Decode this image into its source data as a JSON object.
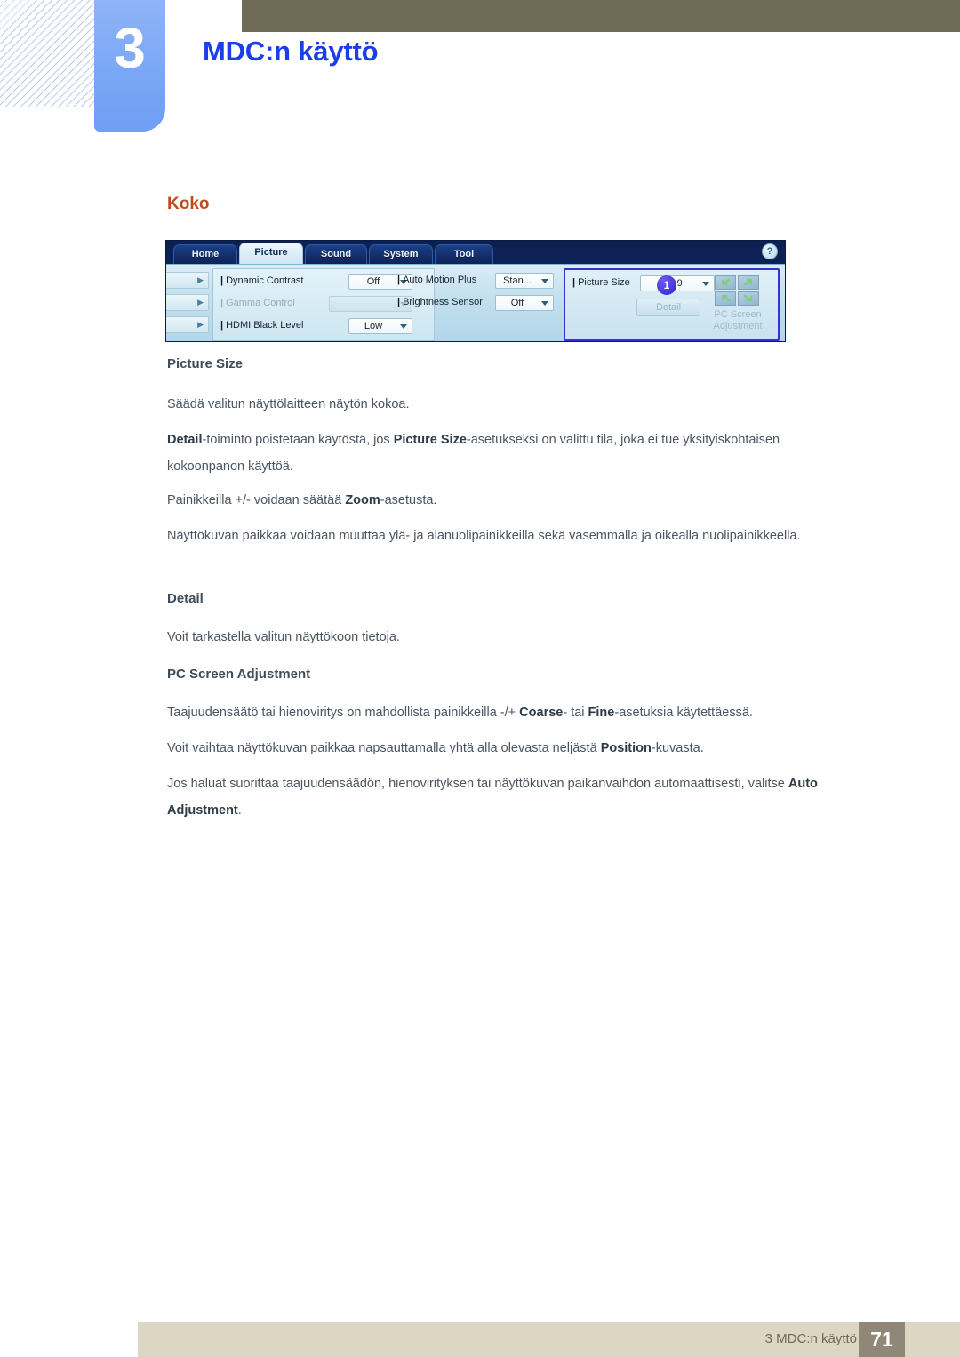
{
  "header": {
    "chapter_number": "3",
    "title": "MDC:n käyttö"
  },
  "section": {
    "heading": "Koko"
  },
  "mdc_app": {
    "tabs": [
      {
        "label": "Home",
        "active": false
      },
      {
        "label": "Picture",
        "active": true
      },
      {
        "label": "Sound",
        "active": false
      },
      {
        "label": "System",
        "active": false
      },
      {
        "label": "Tool",
        "active": false
      }
    ],
    "help_icon": "?",
    "left_group": [
      {
        "label": "Dynamic Contrast",
        "value": "Off",
        "disabled": false
      },
      {
        "label": "Gamma Control",
        "value": "",
        "disabled": true
      },
      {
        "label": "HDMI Black Level",
        "value": "Low",
        "disabled": false
      }
    ],
    "middle_group": [
      {
        "label": "Auto Motion Plus",
        "value": "Stan...",
        "disabled": false
      },
      {
        "label": "Brightness Sensor",
        "value": "Off",
        "disabled": false
      }
    ],
    "right_group": {
      "callout_badge": "1",
      "picture_size_label": "Picture Size",
      "picture_size_value": "16 : 9",
      "detail_button": "Detail",
      "pc_screen_adjustment_label": "PC Screen Adjustment"
    }
  },
  "content": {
    "h_picture_size": "Picture Size",
    "p1": "Säädä valitun näyttölaitteen näytön kokoa.",
    "p2_a": "Detail",
    "p2_b": "-toiminto poistetaan käytöstä, jos ",
    "p2_c": "Picture Size",
    "p2_d": "-asetukseksi on valittu tila, joka ei tue yksityiskohtaisen kokoonpanon käyttöä.",
    "p3_a": "Painikkeilla +/- voidaan säätää ",
    "p3_b": "Zoom",
    "p3_c": "-asetusta.",
    "p4": "Näyttökuvan paikkaa voidaan muuttaa ylä- ja alanuolipainikkeilla sekä vasemmalla ja oikealla nuolipainikkeella.",
    "h_detail": "Detail",
    "p5": "Voit tarkastella valitun näyttökoon tietoja.",
    "h_pcsa": "PC Screen Adjustment",
    "p6_a": "Taajuudensäätö tai hienoviritys on mahdollista painikkeilla -/+ ",
    "p6_b": "Coarse",
    "p6_c": "- tai ",
    "p6_d": "Fine",
    "p6_e": "-asetuksia käytettäessä.",
    "p7_a": "Voit vaihtaa näyttökuvan paikkaa napsauttamalla yhtä alla olevasta neljästä ",
    "p7_b": "Position",
    "p7_c": "-kuvasta.",
    "p8_a": "Jos haluat suorittaa taajuudensäädön, hienovirityksen tai näyttökuvan paikanvaihdon automaattisesti, valitse ",
    "p8_b": "Auto Adjustment",
    "p8_c": "."
  },
  "footer": {
    "text": "3 MDC:n käyttö",
    "page_number": "71"
  },
  "colors": {
    "header_bar": "#6e6a56",
    "chapter_box": "#7aa7f5",
    "title_blue": "#1a3fe8",
    "section_orange": "#c14a18",
    "footer_bar": "#ddd6c3",
    "page_badge": "#918779",
    "callout_blue": "#3322c9"
  }
}
